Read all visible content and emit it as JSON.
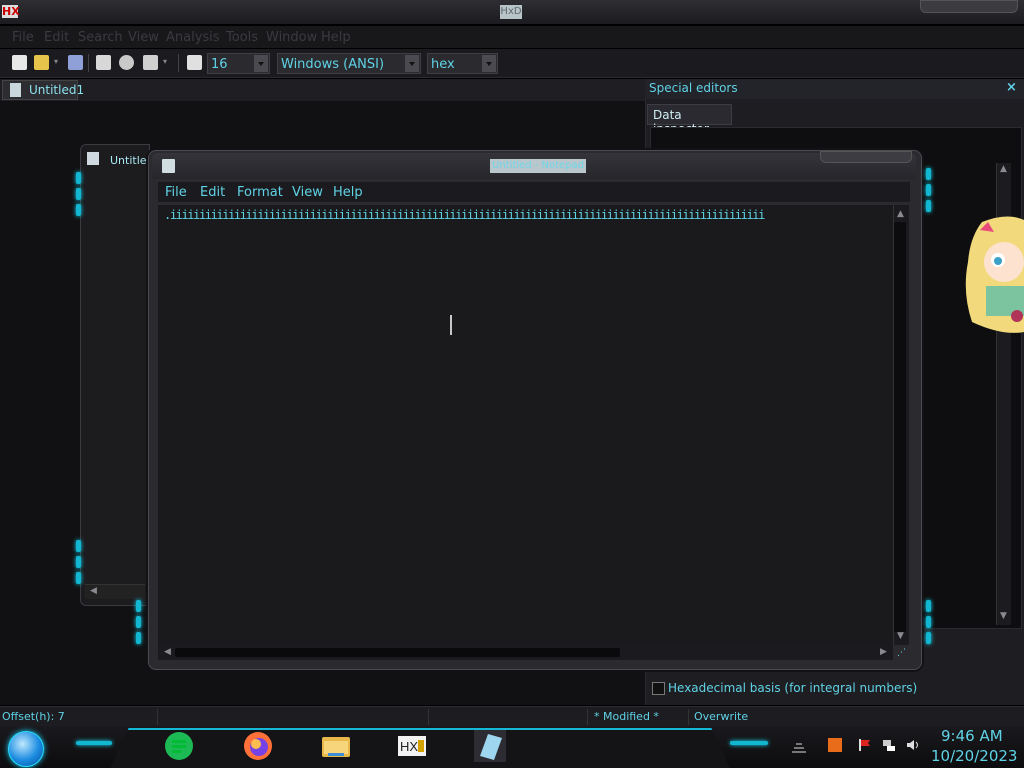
{
  "hxd": {
    "title": "HxD",
    "logo_text": "HX",
    "menu": [
      "File",
      "Edit",
      "Search",
      "View",
      "Analysis",
      "Tools",
      "Window",
      "Help"
    ],
    "toolbar": {
      "bytes_per_row": "16",
      "charset": "Windows (ANSI)",
      "mode": "hex"
    },
    "doc_tab": "Untitled1",
    "special_editors": {
      "title": "Special editors",
      "close": "×",
      "tab": "Data inspector",
      "hex_basis_label": "Hexadecimal basis (for integral numbers)"
    },
    "status": {
      "offset": "Offset(h): 7",
      "modified": "* Modified *",
      "mode": "Overwrite"
    }
  },
  "bg_window": {
    "title": "Untitle"
  },
  "notepad": {
    "title": "Untitled - Notepad",
    "menu": [
      "File",
      "Edit",
      "Format",
      "View",
      "Help"
    ],
    "content": ".iiiiiiiiiiiiiiiiiiiiiiiiiiiiiiiiiiiiiiiiiiiiiiiiiiiiiiiiiiiiiiiiiiiiiiiiiiiiiiiiiiiiiiiiiiiiiiiiiiiiii"
  },
  "taskbar": {
    "time": "9:46 AM",
    "date": "10/20/2023",
    "apps": [
      "spreadsheet-app-icon",
      "firefox-icon",
      "file-explorer-icon",
      "hxd-icon",
      "notepad-icon"
    ]
  },
  "colors": {
    "accent": "#5fd3e6",
    "glow": "#12b6d0"
  }
}
